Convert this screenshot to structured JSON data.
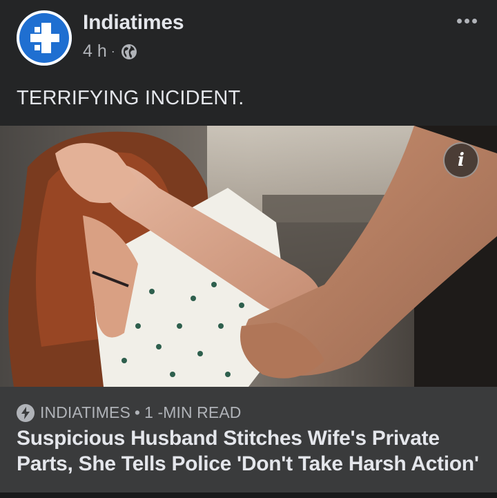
{
  "post": {
    "page_name": "Indiatimes",
    "time": "4 h",
    "separator": "·",
    "privacy_icon": "globe-icon",
    "more_icon": "more-options-icon",
    "caption": "TERRIFYING INCIDENT."
  },
  "media": {
    "info_label": "i"
  },
  "link_preview": {
    "source_icon": "instant-article-bolt-icon",
    "source": "INDIATIMES",
    "separator": "•",
    "read_time": "1 -MIN READ",
    "headline": "Suspicious Husband Stitches Wife's Private Parts, She Tells Police 'Don't Take Harsh Action'"
  },
  "colors": {
    "background": "#242526",
    "link_box": "#3a3b3c",
    "primary_text": "#e4e6eb",
    "secondary_text": "#b0b3b8",
    "brand_blue": "#1f6fd1"
  }
}
